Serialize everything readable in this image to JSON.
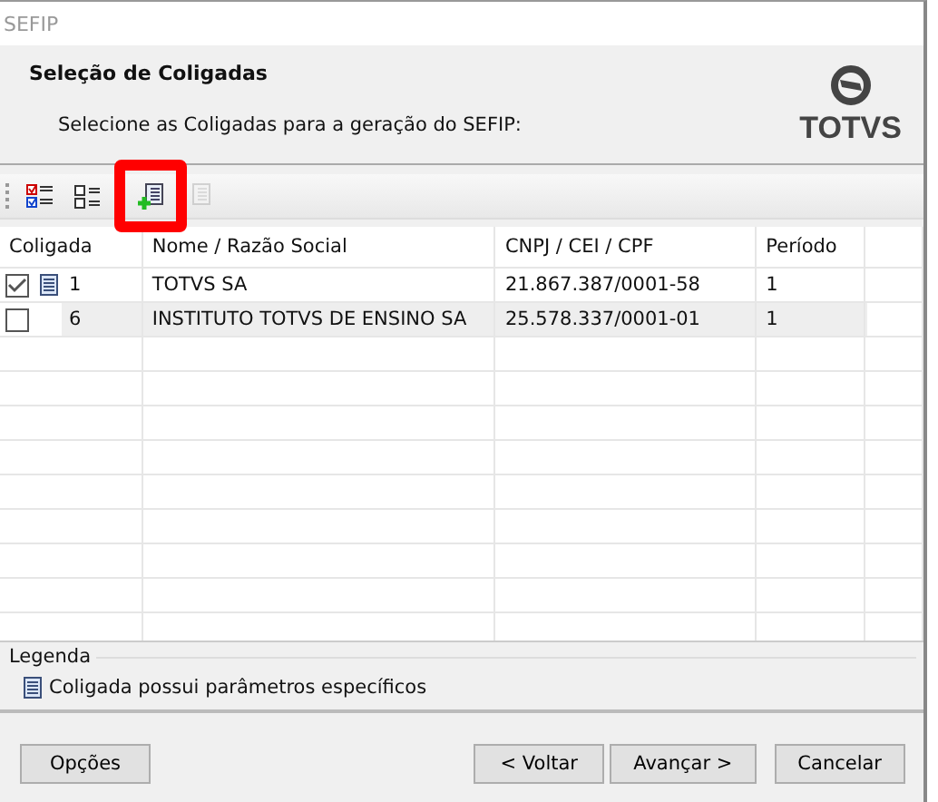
{
  "window": {
    "title": "SEFIP"
  },
  "header": {
    "title": "Seleção de Coligadas",
    "subtitle": "Selecione as Coligadas para a geração do SEFIP:",
    "logo": "TOTVS"
  },
  "toolbar": [
    {
      "kind": "check-all",
      "highlighted": false,
      "disabled": false
    },
    {
      "kind": "uncheck-all",
      "highlighted": false,
      "disabled": false
    },
    {
      "kind": "add-params",
      "highlighted": true,
      "disabled": false
    },
    {
      "kind": "remove-params",
      "highlighted": false,
      "disabled": true
    }
  ],
  "table": {
    "columns": [
      "Coligada",
      "Nome / Razão Social",
      "CNPJ / CEI / CPF",
      "Período"
    ],
    "rows": [
      {
        "checked": true,
        "has_params": true,
        "selected": false,
        "code": "1",
        "name": "TOTVS SA",
        "cnpj": "21.867.387/0001-58",
        "period": "1"
      },
      {
        "checked": false,
        "has_params": false,
        "selected": true,
        "code": "6",
        "name": "INSTITUTO TOTVS DE ENSINO SA",
        "cnpj": "25.578.337/0001-01",
        "period": "1"
      }
    ]
  },
  "legend": {
    "title": "Legenda",
    "text": "Coligada possui parâmetros específicos"
  },
  "buttons": {
    "left": [
      "Opções"
    ],
    "right": [
      "< Voltar",
      "Avançar >",
      "Cancelar"
    ]
  }
}
